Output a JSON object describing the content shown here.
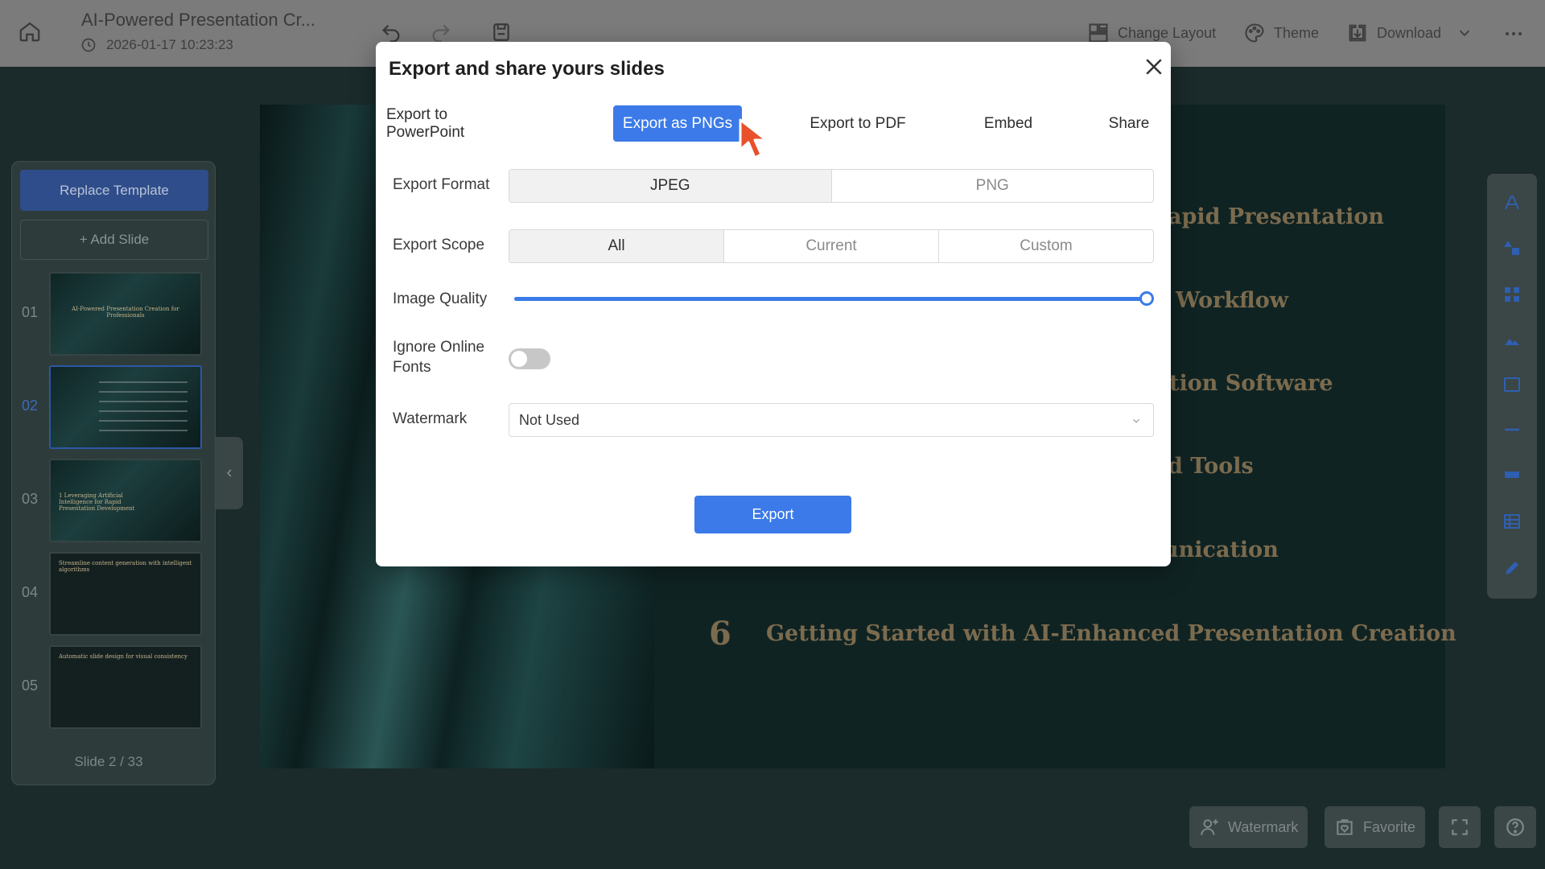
{
  "header": {
    "doc_title": "AI-Powered Presentation Cr...",
    "doc_time": "2026-01-17 10:23:23",
    "change_layout": "Change Layout",
    "theme": "Theme",
    "download": "Download"
  },
  "sidebar": {
    "replace_template": "Replace Template",
    "add_slide": "+ Add Slide",
    "slides": [
      {
        "num": "01",
        "thumb_text": "AI-Powered Presentation Creation for Professionals"
      },
      {
        "num": "02",
        "thumb_text": ""
      },
      {
        "num": "03",
        "thumb_text": "1 Leveraging Artificial Intelligence for Rapid Presentation Development"
      },
      {
        "num": "04",
        "thumb_text": "Streamline content generation with intelligent algorithms"
      },
      {
        "num": "05",
        "thumb_text": "Automatic slide design for visual consistency"
      }
    ],
    "counter": "Slide 2 / 33"
  },
  "canvas": {
    "agenda": [
      "apid Presentation",
      "Workflow",
      "tion Software",
      "d Tools",
      "unication"
    ],
    "last_item_number": "6",
    "last_item_text": "Getting Started with AI-Enhanced Presentation Creation"
  },
  "bottom": {
    "watermark": "Watermark",
    "favorite": "Favorite"
  },
  "modal": {
    "title": "Export and share yours slides",
    "tabs": [
      "Export to PowerPoint",
      "Export as PNGs",
      "Export to PDF",
      "Embed",
      "Share"
    ],
    "active_tab": "Export as PNGs",
    "export_format_label": "Export Format",
    "export_format_options": [
      "JPEG",
      "PNG"
    ],
    "export_format_selected": "JPEG",
    "export_scope_label": "Export Scope",
    "export_scope_options": [
      "All",
      "Current",
      "Custom"
    ],
    "export_scope_selected": "All",
    "image_quality_label": "Image Quality",
    "image_quality_value": 1.0,
    "ignore_fonts_label_line1": "Ignore Online",
    "ignore_fonts_label_line2": "Fonts",
    "ignore_fonts_on": false,
    "watermark_label": "Watermark",
    "watermark_value": "Not Used",
    "export_button": "Export"
  },
  "colors": {
    "accent": "#3b7ae8",
    "topbar": "#7b7b7b",
    "background": "#1b2a2a"
  }
}
